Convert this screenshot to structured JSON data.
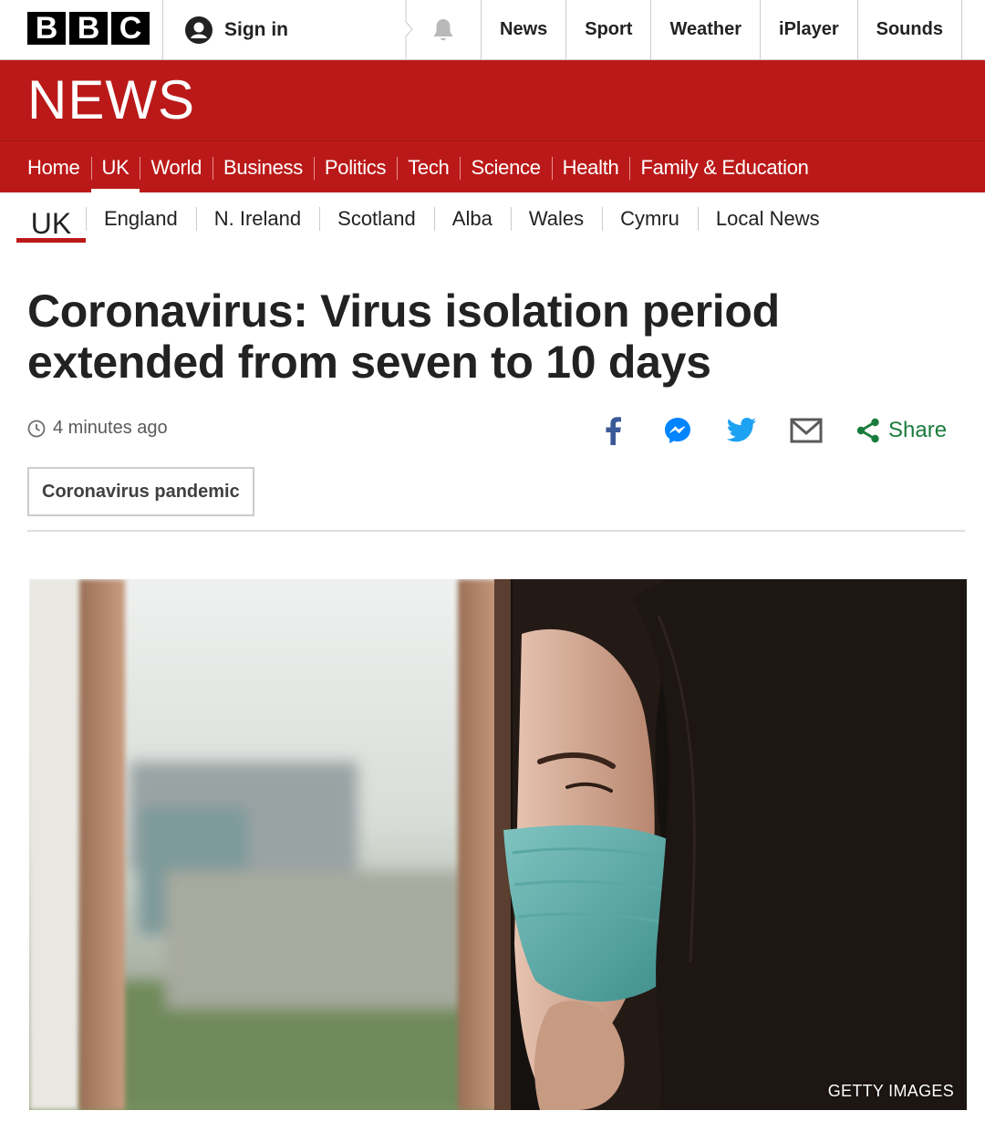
{
  "brand": {
    "letters": [
      "B",
      "B",
      "C"
    ]
  },
  "account": {
    "signin_label": "Sign in"
  },
  "top_nav": [
    "News",
    "Sport",
    "Weather",
    "iPlayer",
    "Sounds"
  ],
  "banner": {
    "wordmark": "NEWS"
  },
  "primary_nav": {
    "items": [
      "Home",
      "UK",
      "World",
      "Business",
      "Politics",
      "Tech",
      "Science",
      "Health",
      "Family & Education"
    ],
    "active": "UK"
  },
  "secondary_nav": {
    "section": "UK",
    "items": [
      "England",
      "N. Ireland",
      "Scotland",
      "Alba",
      "Wales",
      "Cymru",
      "Local News"
    ]
  },
  "story": {
    "headline": "Coronavirus: Virus isolation period extended from seven to 10 days",
    "timestamp": "4 minutes ago",
    "share_label": "Share",
    "tag": "Coronavirus pandemic",
    "image_credit": "GETTY IMAGES"
  },
  "share_services": [
    "facebook-icon",
    "messenger-icon",
    "twitter-icon",
    "email-icon",
    "share-icon"
  ],
  "colors": {
    "bbc_red": "#bb1919",
    "share_green": "#1a7c3c",
    "facebook_blue": "#3b5998",
    "messenger_blue": "#0084ff",
    "twitter_blue": "#1da1f2"
  }
}
